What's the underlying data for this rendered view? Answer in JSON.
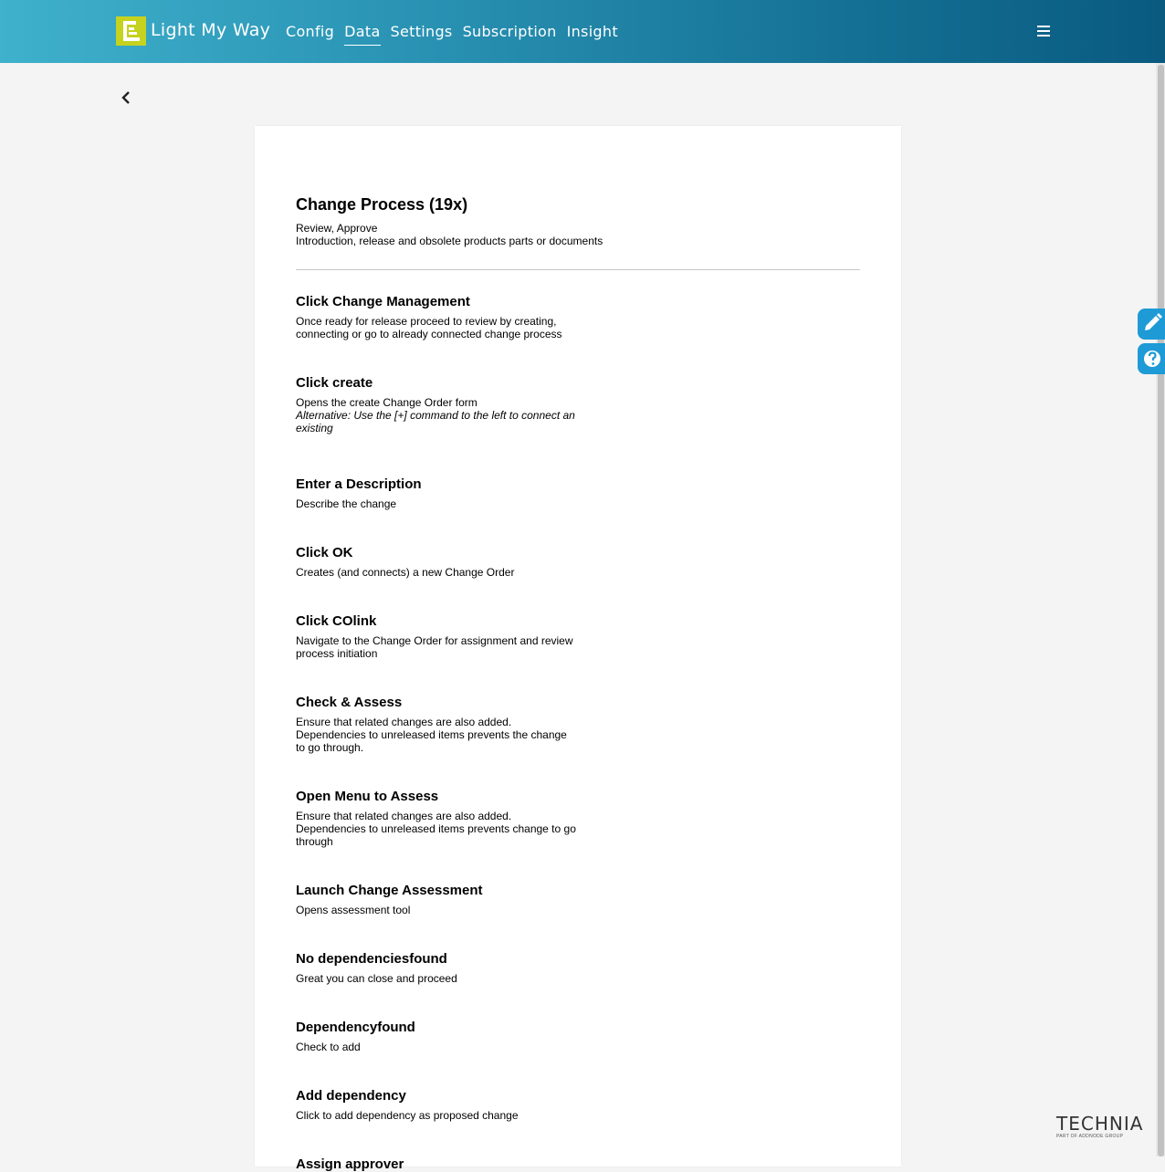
{
  "header": {
    "app_name": "Light My Way",
    "nav": [
      "Config",
      "Data",
      "Settings",
      "Subscription",
      "Insight"
    ],
    "active_nav": "Data",
    "menu_icon": "hamburger-icon"
  },
  "colors": {
    "header_gradient_start": "#3fb1cc",
    "header_gradient_end": "#0a5a80",
    "logo_accent": "#c5d21e",
    "side_button": "#1e9ad6"
  },
  "card": {
    "title": "Change Process (19x)",
    "subtitle_line1": "Review, Approve",
    "subtitle_line2": "Introduction, release and obsolete products parts or documents",
    "steps": [
      {
        "title": "Click Change Management",
        "desc": [
          "Once ready for release proceed to review by creating,",
          "connecting or go to already connected change process"
        ]
      },
      {
        "title": "Click create",
        "desc": [
          "Opens the create Change Order form"
        ],
        "alt": [
          "Alternative: Use the [+] command to the left to connect an",
          "existing"
        ]
      },
      {
        "title": "Enter a Description",
        "desc": [
          "Describe the change"
        ]
      },
      {
        "title": "Click OK",
        "desc": [
          "Creates (and connects) a new Change Order"
        ]
      },
      {
        "title": "Click COlink",
        "desc": [
          "Navigate to the Change Order for assignment and review",
          "process initiation"
        ]
      },
      {
        "title": "Check & Assess",
        "desc": [
          "Ensure that related changes are also added.",
          "Dependencies to unreleased items prevents the change",
          "to go through."
        ]
      },
      {
        "title": "Open Menu to Assess",
        "desc": [
          "Ensure that related changes are also added.",
          "Dependencies to unreleased items prevents change to go",
          "through"
        ]
      },
      {
        "title": "Launch Change Assessment",
        "desc": [
          "Opens assessment tool"
        ]
      },
      {
        "title": "No dependenciesfound",
        "desc": [
          "Great you can close and proceed"
        ]
      },
      {
        "title": "Dependencyfound",
        "desc": [
          "Check to add"
        ]
      },
      {
        "title": "Add dependency",
        "desc": [
          "Click to add dependency as proposed change"
        ]
      },
      {
        "title": "Assign approver",
        "desc": []
      }
    ]
  },
  "side_buttons": {
    "edit_icon": "pencil-icon",
    "help_icon": "question-icon"
  },
  "footer": {
    "brand": "TECHNIA",
    "tagline": "PART OF ADDNODE GROUP"
  }
}
